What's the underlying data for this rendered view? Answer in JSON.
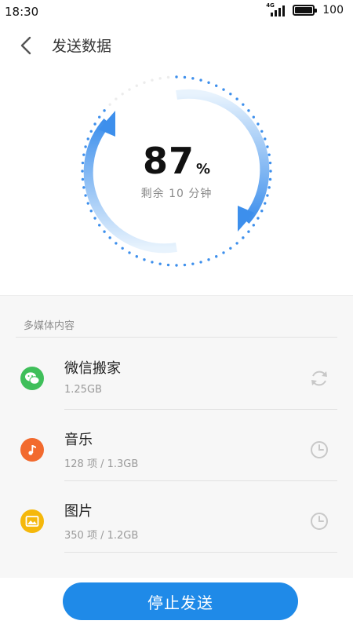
{
  "status_bar": {
    "time": "18:30",
    "network": "4G",
    "battery": "100"
  },
  "header": {
    "title": "发送数据",
    "back_icon": "chevron-left-icon"
  },
  "progress": {
    "percent_value": "87",
    "percent_sign": "%",
    "percent_fraction": 0.87,
    "remaining": "剩余 10 分钟",
    "ring_color": "#3d8fec"
  },
  "media": {
    "section_label": "多媒体内容",
    "items": [
      {
        "name": "微信搬家",
        "detail": "1.25GB",
        "icon": "wechat-icon",
        "icon_color": "#3fbf5a",
        "state": "syncing-icon"
      },
      {
        "name": "音乐",
        "detail": "128 项 / 1.3GB",
        "icon": "music-icon",
        "icon_color": "#f26a2e",
        "state": "clock-icon"
      },
      {
        "name": "图片",
        "detail": "350 项 / 1.2GB",
        "icon": "picture-icon",
        "icon_color": "#f5b80b",
        "state": "clock-icon"
      }
    ]
  },
  "actions": {
    "stop_label": "停止发送",
    "button_color": "#1f8ae8"
  }
}
